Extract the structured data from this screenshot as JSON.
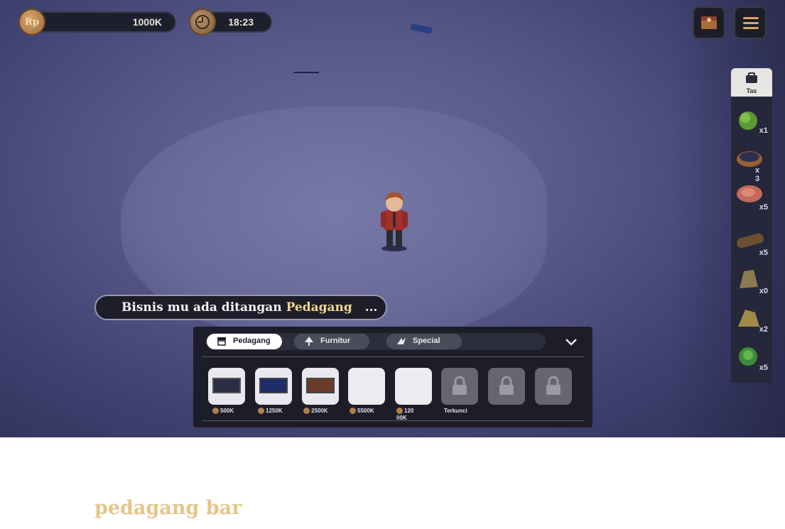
{
  "hud": {
    "money": {
      "currency_symbol": "Rp",
      "value": "1000K"
    },
    "clock": {
      "time": "18:23"
    },
    "top_buttons": [
      {
        "name": "chest-icon"
      },
      {
        "name": "menu-icon"
      }
    ]
  },
  "inventory": {
    "bag_label": "Tas",
    "items": [
      {
        "icon": "cabbage-icon",
        "count": "x1"
      },
      {
        "icon": "basket-icon",
        "count": "x 3"
      },
      {
        "icon": "meat-icon",
        "count": "x5"
      },
      {
        "icon": "log-icon",
        "count": "x5"
      },
      {
        "icon": "stone-icon",
        "count": "x0"
      },
      {
        "icon": "ore-icon",
        "count": "x2"
      },
      {
        "icon": "herb-icon",
        "count": "x5"
      }
    ]
  },
  "message": {
    "prefix": "Bisnis mu ada ditangan",
    "highlight": "Pedagang",
    "ellipsis": "...",
    "highlight_color": "#f2d68e"
  },
  "shop": {
    "tabs": [
      {
        "label": "Pedagang",
        "icon": "shop-icon",
        "active": true
      },
      {
        "label": "Furnitur",
        "icon": "tree-icon",
        "active": false
      },
      {
        "label": "Special",
        "icon": "special-icon",
        "active": false
      }
    ],
    "slots": [
      {
        "state": "image",
        "price": "500K"
      },
      {
        "state": "image",
        "price": "1250K"
      },
      {
        "state": "image",
        "price": "2500K"
      },
      {
        "state": "empty",
        "price": "5500K"
      },
      {
        "state": "empty",
        "price": "120 00K"
      },
      {
        "state": "locked",
        "price": "Terkunci"
      },
      {
        "state": "locked",
        "price": ""
      },
      {
        "state": "locked",
        "price": ""
      }
    ]
  },
  "caption": "pedagang bar",
  "colors": {
    "accent": "#e6c589",
    "panel": "#1c1d28",
    "coin": "#b0804f"
  }
}
